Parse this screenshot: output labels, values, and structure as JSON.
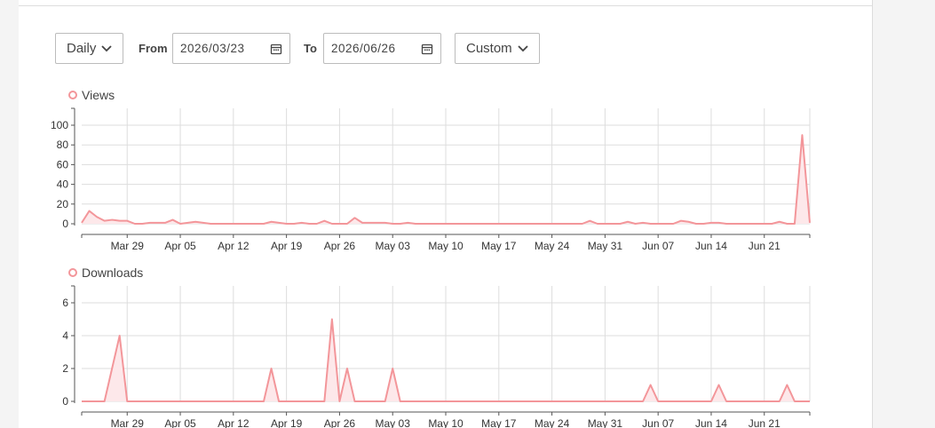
{
  "controls": {
    "granularity": "Daily",
    "from_label": "From",
    "from_date": "2026/03/23",
    "to_label": "To",
    "to_date": "2026/06/26",
    "range_preset": "Custom"
  },
  "colors": {
    "series": "#f3969a",
    "fill": "#fde8ea",
    "grid": "#dddddd",
    "axis": "#555555"
  },
  "chart_data": [
    {
      "type": "area",
      "legend": "Views",
      "x_start": "2026-03-23",
      "x_end": "2026-06-26",
      "x_ticks": [
        "Mar 29",
        "Apr 05",
        "Apr 12",
        "Apr 19",
        "Apr 26",
        "May 03",
        "May 10",
        "May 17",
        "May 24",
        "May 31",
        "Jun 07",
        "Jun 14",
        "Jun 21"
      ],
      "ylim": [
        0,
        100
      ],
      "y_ticks": [
        0,
        20,
        40,
        60,
        80,
        100
      ],
      "series": [
        {
          "values": [
            1,
            13,
            7,
            3,
            4,
            3,
            3,
            0,
            0,
            1,
            1,
            1,
            4,
            0,
            1,
            2,
            1,
            0,
            0,
            0,
            0,
            0,
            0,
            0,
            0,
            2,
            1,
            0,
            0,
            1,
            0,
            0,
            3,
            0,
            0,
            0,
            6,
            1,
            1,
            1,
            1,
            0,
            0,
            1,
            0,
            0,
            0,
            0,
            0,
            0,
            0,
            0,
            0,
            0,
            0,
            0,
            0,
            0,
            0,
            0,
            0,
            0,
            0,
            0,
            0,
            0,
            0,
            3,
            0,
            0,
            0,
            0,
            2,
            0,
            1,
            0,
            0,
            0,
            0,
            3,
            2,
            0,
            0,
            1,
            1,
            0,
            0,
            0,
            0,
            0,
            0,
            0,
            2,
            0,
            0,
            90,
            1
          ]
        }
      ]
    },
    {
      "type": "area",
      "legend": "Downloads",
      "x_start": "2026-03-23",
      "x_end": "2026-06-26",
      "x_ticks": [
        "Mar 29",
        "Apr 05",
        "Apr 12",
        "Apr 19",
        "Apr 26",
        "May 03",
        "May 10",
        "May 17",
        "May 24",
        "May 31",
        "Jun 07",
        "Jun 14",
        "Jun 21"
      ],
      "ylim": [
        0,
        7
      ],
      "y_ticks": [
        0,
        2,
        4,
        6
      ],
      "series": [
        {
          "values": [
            0,
            0,
            0,
            0,
            2,
            4,
            0,
            0,
            0,
            0,
            0,
            0,
            0,
            0,
            0,
            0,
            0,
            0,
            0,
            0,
            0,
            0,
            0,
            0,
            0,
            2,
            0,
            0,
            0,
            0,
            0,
            0,
            0,
            5,
            0,
            2,
            0,
            0,
            0,
            0,
            0,
            2,
            0,
            0,
            0,
            0,
            0,
            0,
            0,
            0,
            0,
            0,
            0,
            0,
            0,
            0,
            0,
            0,
            0,
            0,
            0,
            0,
            0,
            0,
            0,
            0,
            0,
            0,
            0,
            0,
            0,
            0,
            0,
            0,
            0,
            1,
            0,
            0,
            0,
            0,
            0,
            0,
            0,
            0,
            1,
            0,
            0,
            0,
            0,
            0,
            0,
            0,
            0,
            1,
            0,
            0,
            0
          ]
        }
      ]
    }
  ]
}
